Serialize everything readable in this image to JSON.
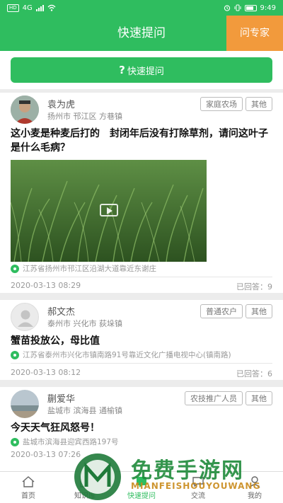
{
  "status_bar": {
    "sim_badge": "HD",
    "network": "4G",
    "time": "9:49"
  },
  "header": {
    "title": "快速提问",
    "ask_expert": "问专家"
  },
  "quick_ask": {
    "label": "快速提问",
    "icon": "question-mark-icon"
  },
  "questions": [
    {
      "user": "袁为虎",
      "location": "扬州市 邗江区 方巷镇",
      "tags": [
        "家庭农场",
        "其他"
      ],
      "title": "这小麦是种麦后打的　封闭年后没有打除草剂，请问这叶子是什么毛病？",
      "address": "江苏省扬州市邗江区沿湖大道靠近东谢庄",
      "date": "2020-03-13 08:29",
      "answers": "已回答：9",
      "has_video": true
    },
    {
      "user": "郝文杰",
      "location": "泰州市 兴化市 荻垛镇",
      "tags": [
        "普通农户",
        "其他"
      ],
      "title": "蟹苗投放公，母比值",
      "address": "江苏省泰州市兴化市镇南路91号靠近文化广播电视中心(镇南路)",
      "date": "2020-03-13 08:12",
      "answers": "已回答：6"
    },
    {
      "user": "蒯爱华",
      "location": "盐城市 滨海县 通榆镇",
      "tags": [
        "农技推广人员",
        "其他"
      ],
      "title": "今天天气狂风怒号！",
      "address": "盐城市滨海县迎宾西路197号",
      "date": "2020-03-13 07:26"
    }
  ],
  "tabbar": {
    "items": [
      {
        "label": "首页",
        "icon": "home-icon"
      },
      {
        "label": "知识库",
        "icon": "book-icon"
      },
      {
        "label": "快速提问",
        "icon": "question-icon"
      },
      {
        "label": "交流",
        "icon": "chat-icon"
      },
      {
        "label": "我的",
        "icon": "user-icon"
      }
    ]
  },
  "watermark": {
    "zh": "免费手游网",
    "en": "MIANFEISHOUYOUWANG"
  },
  "colors": {
    "primary": "#2fbd5f",
    "accent": "#f29a3c"
  }
}
